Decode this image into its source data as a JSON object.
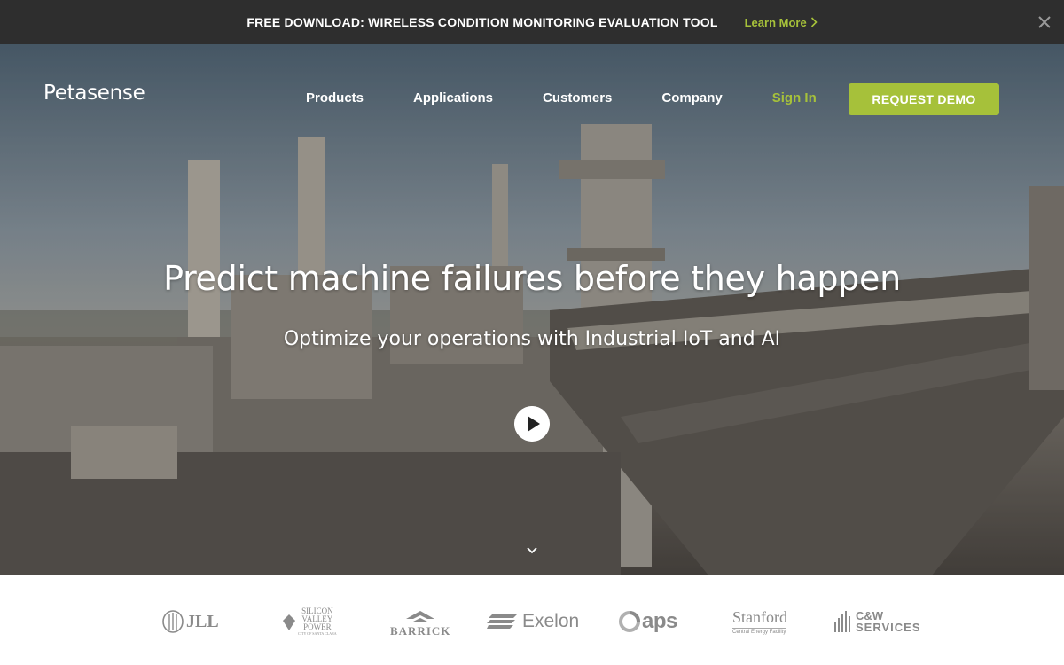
{
  "announcement": {
    "text": "FREE DOWNLOAD: WIRELESS CONDITION MONITORING EVALUATION TOOL",
    "link_label": "Learn More",
    "close_icon": "close-icon"
  },
  "brand": {
    "logo_text": "Petasense",
    "accent_color": "#a6c13a",
    "bar_color": "#2e2e2e"
  },
  "nav": {
    "items": [
      {
        "label": "Products"
      },
      {
        "label": "Applications"
      },
      {
        "label": "Customers"
      },
      {
        "label": "Company"
      }
    ],
    "signin_label": "Sign In",
    "demo_label": "REQUEST DEMO"
  },
  "hero": {
    "headline": "Predict machine failures before they happen",
    "subheadline": "Optimize your operations with Industrial IoT and AI",
    "play_icon": "play-icon",
    "scroll_icon": "chevron-down-icon"
  },
  "clients": {
    "logos": [
      {
        "name": "JLL"
      },
      {
        "name": "Silicon Valley Power",
        "line1": "SILICON",
        "line2": "VALLEY",
        "line3": "POWER",
        "small": "CITY OF SANTA CLARA"
      },
      {
        "name": "BARRICK"
      },
      {
        "name": "Exelon"
      },
      {
        "name": "aps"
      },
      {
        "name": "Stanford",
        "small": "Central Energy Facility"
      },
      {
        "name": "C&W SERVICES",
        "line1": "C&W",
        "line2": "SERVICES"
      }
    ]
  }
}
